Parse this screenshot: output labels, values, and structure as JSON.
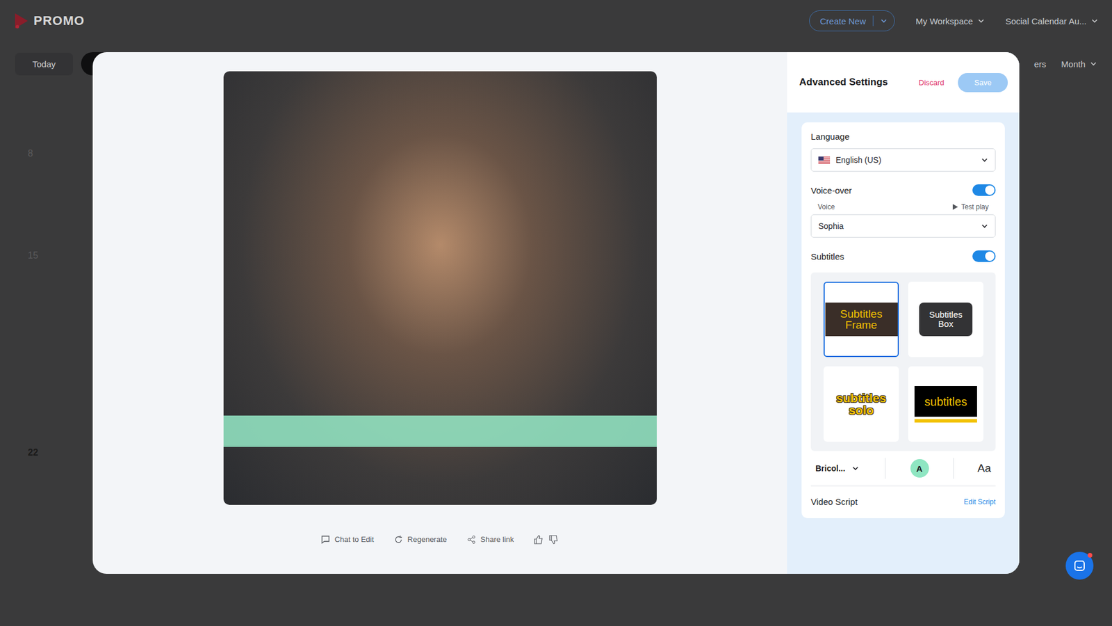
{
  "header": {
    "logo": "PROMO",
    "create_button": "Create New",
    "workspace": "My Workspace",
    "calendar": "Social Calendar Au..."
  },
  "toolbar": {
    "today": "Today",
    "filters": "ers",
    "view": "Month"
  },
  "week_numbers": [
    {
      "label": "8",
      "current": false
    },
    {
      "label": "15",
      "current": false
    },
    {
      "label": "22",
      "current": true
    }
  ],
  "actions": [
    {
      "label": "Chat to Edit",
      "kind": "chat"
    },
    {
      "label": "Regenerate",
      "kind": "regenerate"
    },
    {
      "label": "Share link",
      "kind": "share"
    }
  ],
  "settings": {
    "title": "Advanced Settings",
    "discard": "Discard",
    "save": "Save",
    "save_disabled": true,
    "language": {
      "label": "Language",
      "value": "English (US)"
    },
    "voiceover": {
      "label": "Voice-over",
      "on": true,
      "voice_label": "Voice",
      "test_play": "Test play",
      "voice": "Sophia"
    },
    "subtitles": {
      "label": "Subtitles",
      "on": true,
      "styles": [
        {
          "label": "Subtitles Frame",
          "kind": "frame",
          "selected": true
        },
        {
          "label": "Subtitles Box",
          "kind": "box",
          "selected": false
        },
        {
          "label": "subtitles solo",
          "kind": "solo",
          "selected": false
        },
        {
          "label": "subtitles",
          "kind": "bar",
          "selected": false
        }
      ],
      "font": "Bricol...",
      "color_letter": "A",
      "size_glyph": "Aa"
    },
    "script": {
      "label": "Video Script",
      "edit": "Edit Script"
    }
  },
  "chat_widget": {
    "unread": true
  }
}
